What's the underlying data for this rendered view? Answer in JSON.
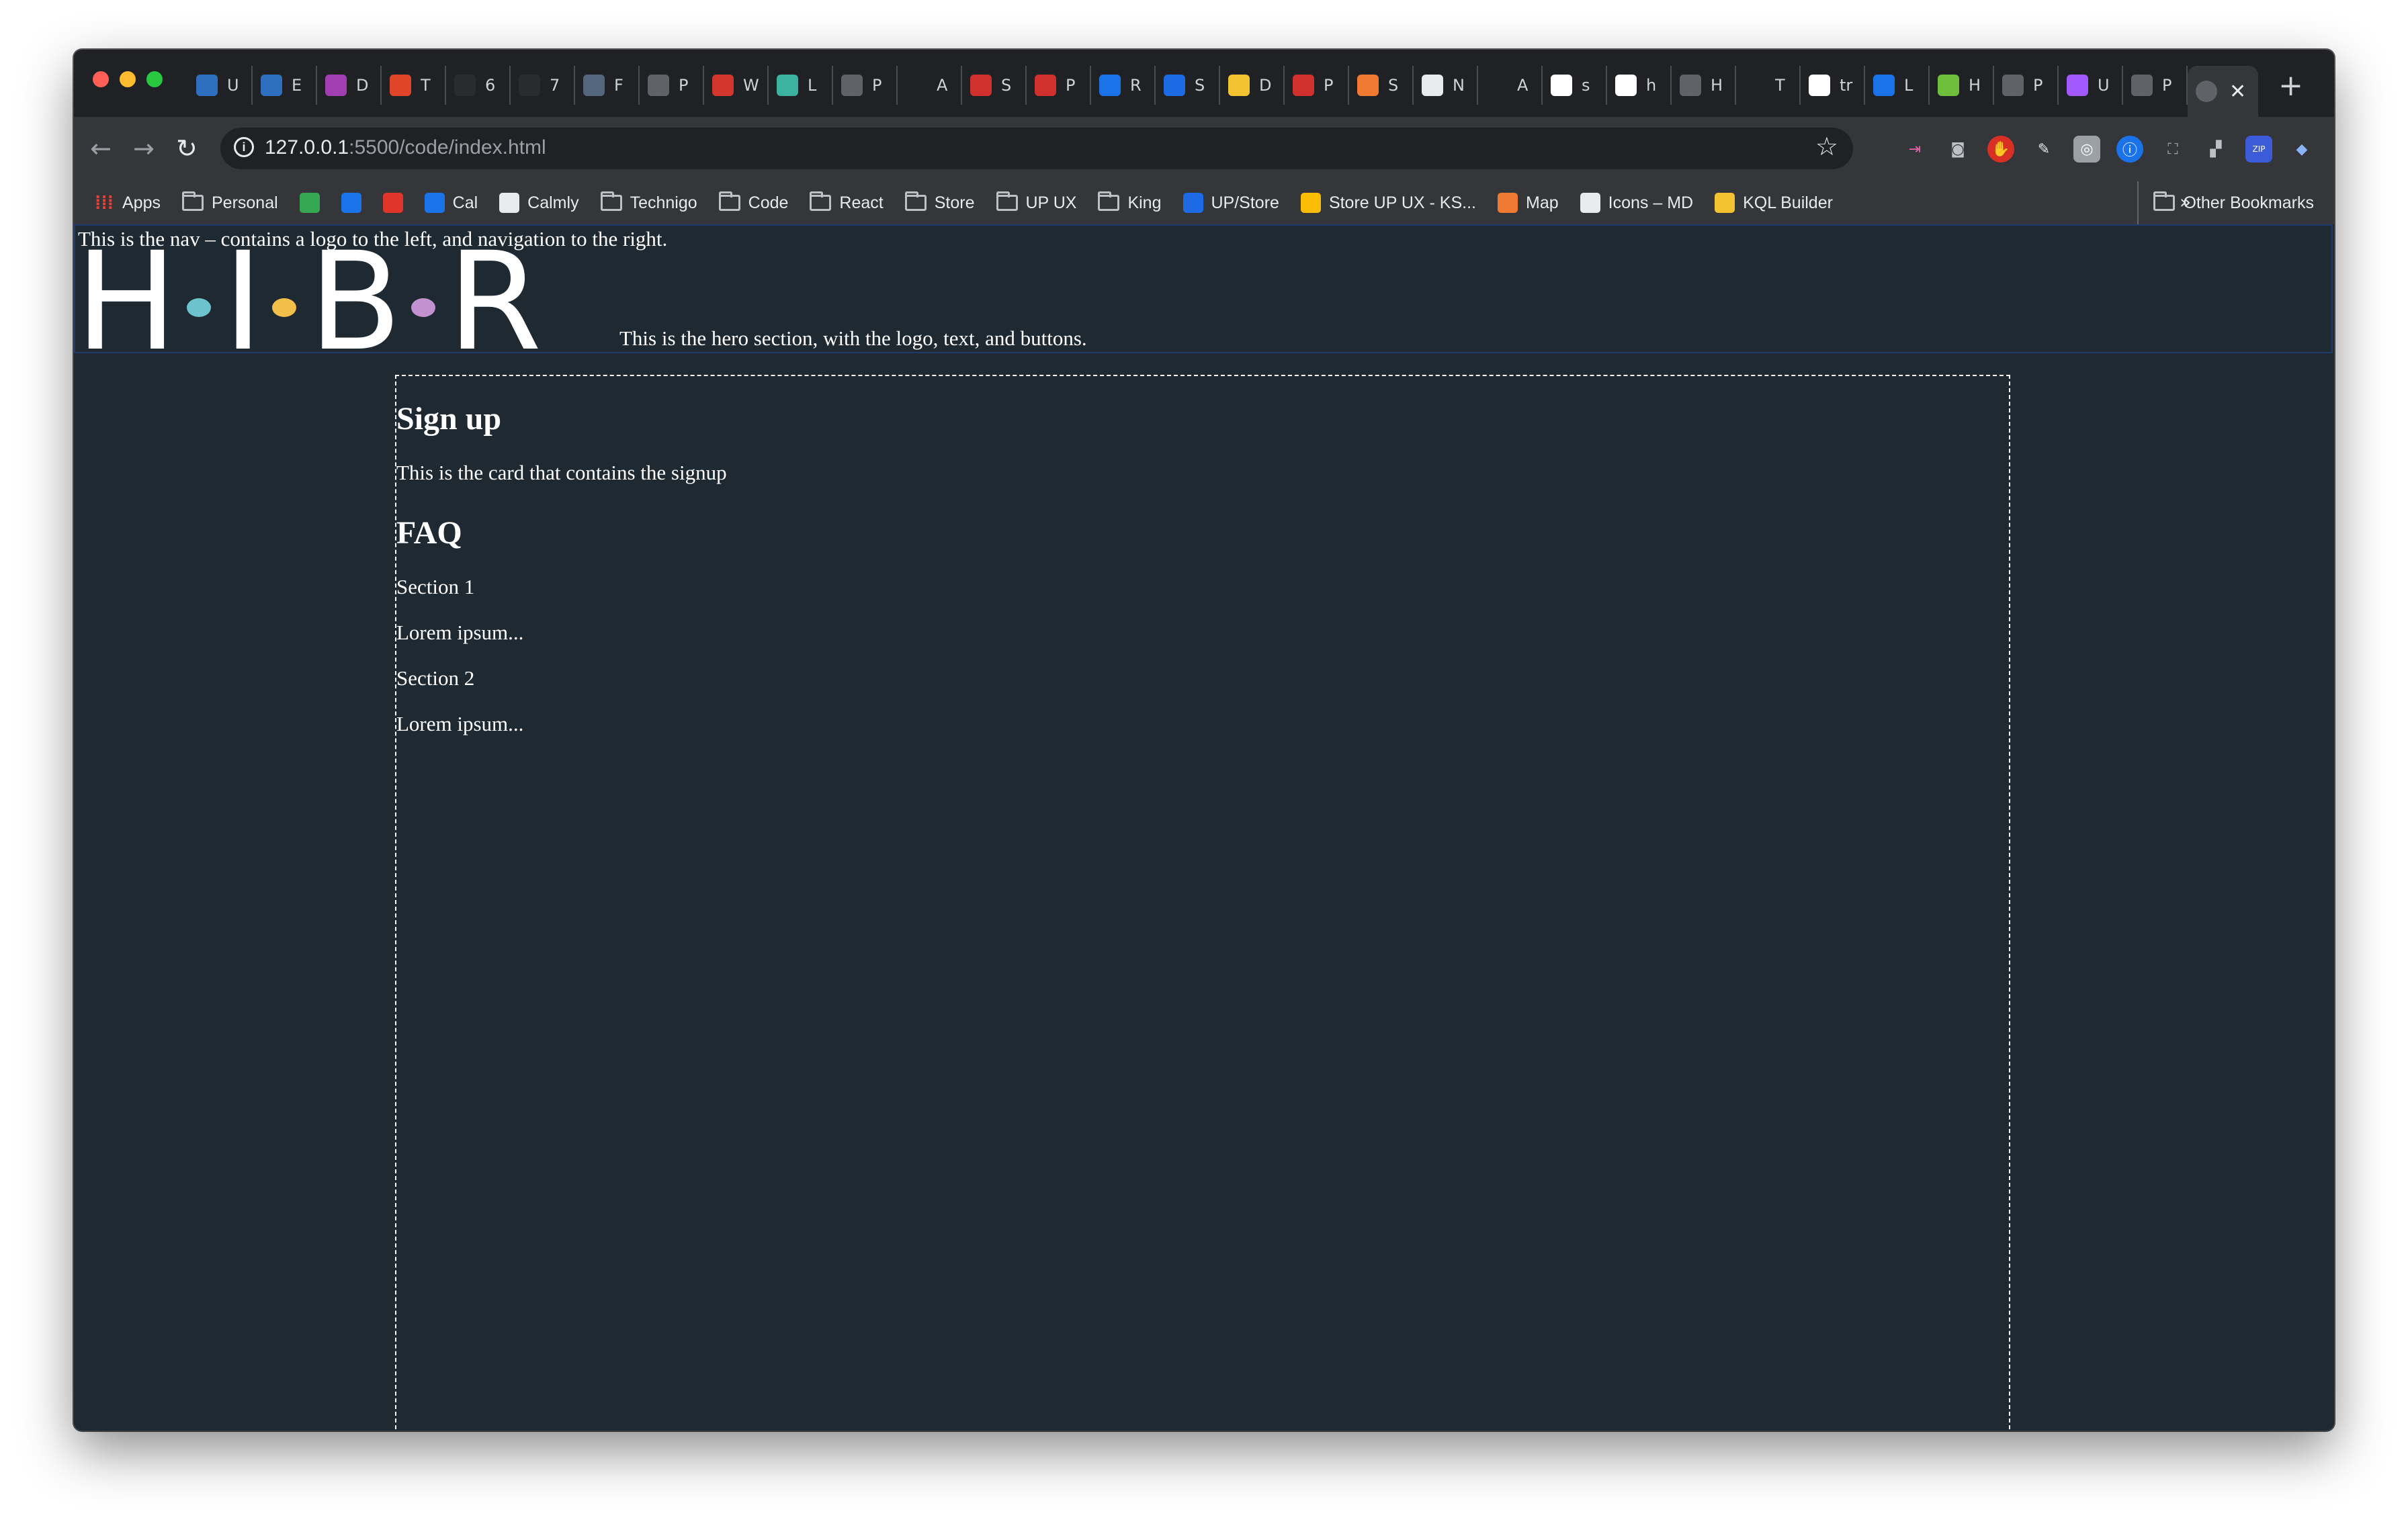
{
  "browser": {
    "tabs": [
      {
        "icon": "image-icon",
        "letter": "U",
        "color": "#2f6fbf"
      },
      {
        "icon": "image-icon",
        "letter": "E",
        "color": "#2f6fbf"
      },
      {
        "icon": "page-icon",
        "letter": "D",
        "color": "#a23fb0"
      },
      {
        "icon": "ux-icon",
        "letter": "T",
        "color": "#e0452a"
      },
      {
        "icon": "circle-icon",
        "letter": "6",
        "color": "#2a2b2e"
      },
      {
        "icon": "circle-icon",
        "letter": "7",
        "color": "#2a2b2e"
      },
      {
        "icon": "page-icon",
        "letter": "F",
        "color": "#54657e"
      },
      {
        "icon": "globe-icon",
        "letter": "P",
        "color": "#5f6368"
      },
      {
        "icon": "wheel-icon",
        "letter": "W",
        "color": "#d2362c"
      },
      {
        "icon": "diamond-icon",
        "letter": "L",
        "color": "#3bb3a0"
      },
      {
        "icon": "globe-icon",
        "letter": "P",
        "color": "#5f6368"
      },
      {
        "icon": "github-icon",
        "letter": "A",
        "color": "#202124"
      },
      {
        "icon": "pr-icon",
        "letter": "S",
        "color": "#d0312d"
      },
      {
        "icon": "pr-icon",
        "letter": "P",
        "color": "#d0312d"
      },
      {
        "icon": "drive-icon",
        "letter": "R",
        "color": "#1a73e8"
      },
      {
        "icon": "trello-icon",
        "letter": "S",
        "color": "#1d6ae5"
      },
      {
        "icon": "miro-icon",
        "letter": "D",
        "color": "#f2c230"
      },
      {
        "icon": "pr-icon",
        "letter": "P",
        "color": "#d0312d"
      },
      {
        "icon": "x-icon",
        "letter": "S",
        "color": "#f07a32"
      },
      {
        "icon": "notion-icon",
        "letter": "N",
        "color": "#e8eaed"
      },
      {
        "icon": "github-icon",
        "letter": "A",
        "color": "#202124"
      },
      {
        "icon": "google-icon",
        "letter": "s",
        "color": "#ffffff"
      },
      {
        "icon": "google-icon",
        "letter": "h",
        "color": "#ffffff"
      },
      {
        "icon": "globe-icon",
        "letter": "H",
        "color": "#5f6368"
      },
      {
        "icon": "medium-icon",
        "letter": "T",
        "color": "#202124"
      },
      {
        "icon": "google-icon",
        "letter": "tr",
        "color": "#ffffff"
      },
      {
        "icon": "f-icon",
        "letter": "L",
        "color": "#1a73e8"
      },
      {
        "icon": "code-icon",
        "letter": "H",
        "color": "#6fbf3c"
      },
      {
        "icon": "globe-icon",
        "letter": "P",
        "color": "#5f6368"
      },
      {
        "icon": "figma-icon",
        "letter": "U",
        "color": "#a259ff"
      },
      {
        "icon": "globe-icon",
        "letter": "P",
        "color": "#5f6368"
      }
    ],
    "active_tab_close": "✕",
    "new_tab": "+",
    "url_host": "127.0.0.1",
    "url_path": ":5500/code/index.html",
    "bookmarks": [
      {
        "label": "Apps",
        "type": "apps",
        "color": "#ea4335"
      },
      {
        "label": "Personal",
        "type": "folder"
      },
      {
        "label": "",
        "type": "icon",
        "color": "#34a853"
      },
      {
        "label": "",
        "type": "icon",
        "color": "#1a73e8"
      },
      {
        "label": "",
        "type": "icon",
        "color": "#e0352a"
      },
      {
        "label": "Cal",
        "type": "icon",
        "color": "#1a73e8"
      },
      {
        "label": "Calmly",
        "type": "icon",
        "color": "#e8eaed"
      },
      {
        "label": "Technigo",
        "type": "folder"
      },
      {
        "label": "Code",
        "type": "folder"
      },
      {
        "label": "React",
        "type": "folder"
      },
      {
        "label": "Store",
        "type": "folder"
      },
      {
        "label": "UP UX",
        "type": "folder"
      },
      {
        "label": "King",
        "type": "folder"
      },
      {
        "label": "UP/Store",
        "type": "icon",
        "color": "#1d6ae5"
      },
      {
        "label": "Store UP UX - KS...",
        "type": "icon",
        "color": "#fbbc04"
      },
      {
        "label": "Map",
        "type": "icon",
        "color": "#f07a32"
      },
      {
        "label": "Icons – MD",
        "type": "icon",
        "color": "#e8eaed"
      },
      {
        "label": "KQL Builder",
        "type": "icon",
        "color": "#f2c230"
      }
    ],
    "bookmarks_more": "»",
    "other_bookmarks": "Other Bookmarks"
  },
  "page": {
    "nav_text": "This is the nav – contains a logo to the left, and navigation to the right.",
    "logo": {
      "letters": [
        "H",
        "I",
        "B",
        "R"
      ],
      "dot_colors": [
        "#6cc3cd",
        "#f2bf4a",
        "#c192cf"
      ]
    },
    "hero_text": "This is the hero section, with the logo, text, and buttons.",
    "card": {
      "heading": "Sign up",
      "text": "This is the card that contains the signup",
      "faq_heading": "FAQ",
      "sections": [
        {
          "title": "Section 1",
          "body": "Lorem ipsum..."
        },
        {
          "title": "Section 2",
          "body": "Lorem ipsum..."
        }
      ]
    }
  }
}
